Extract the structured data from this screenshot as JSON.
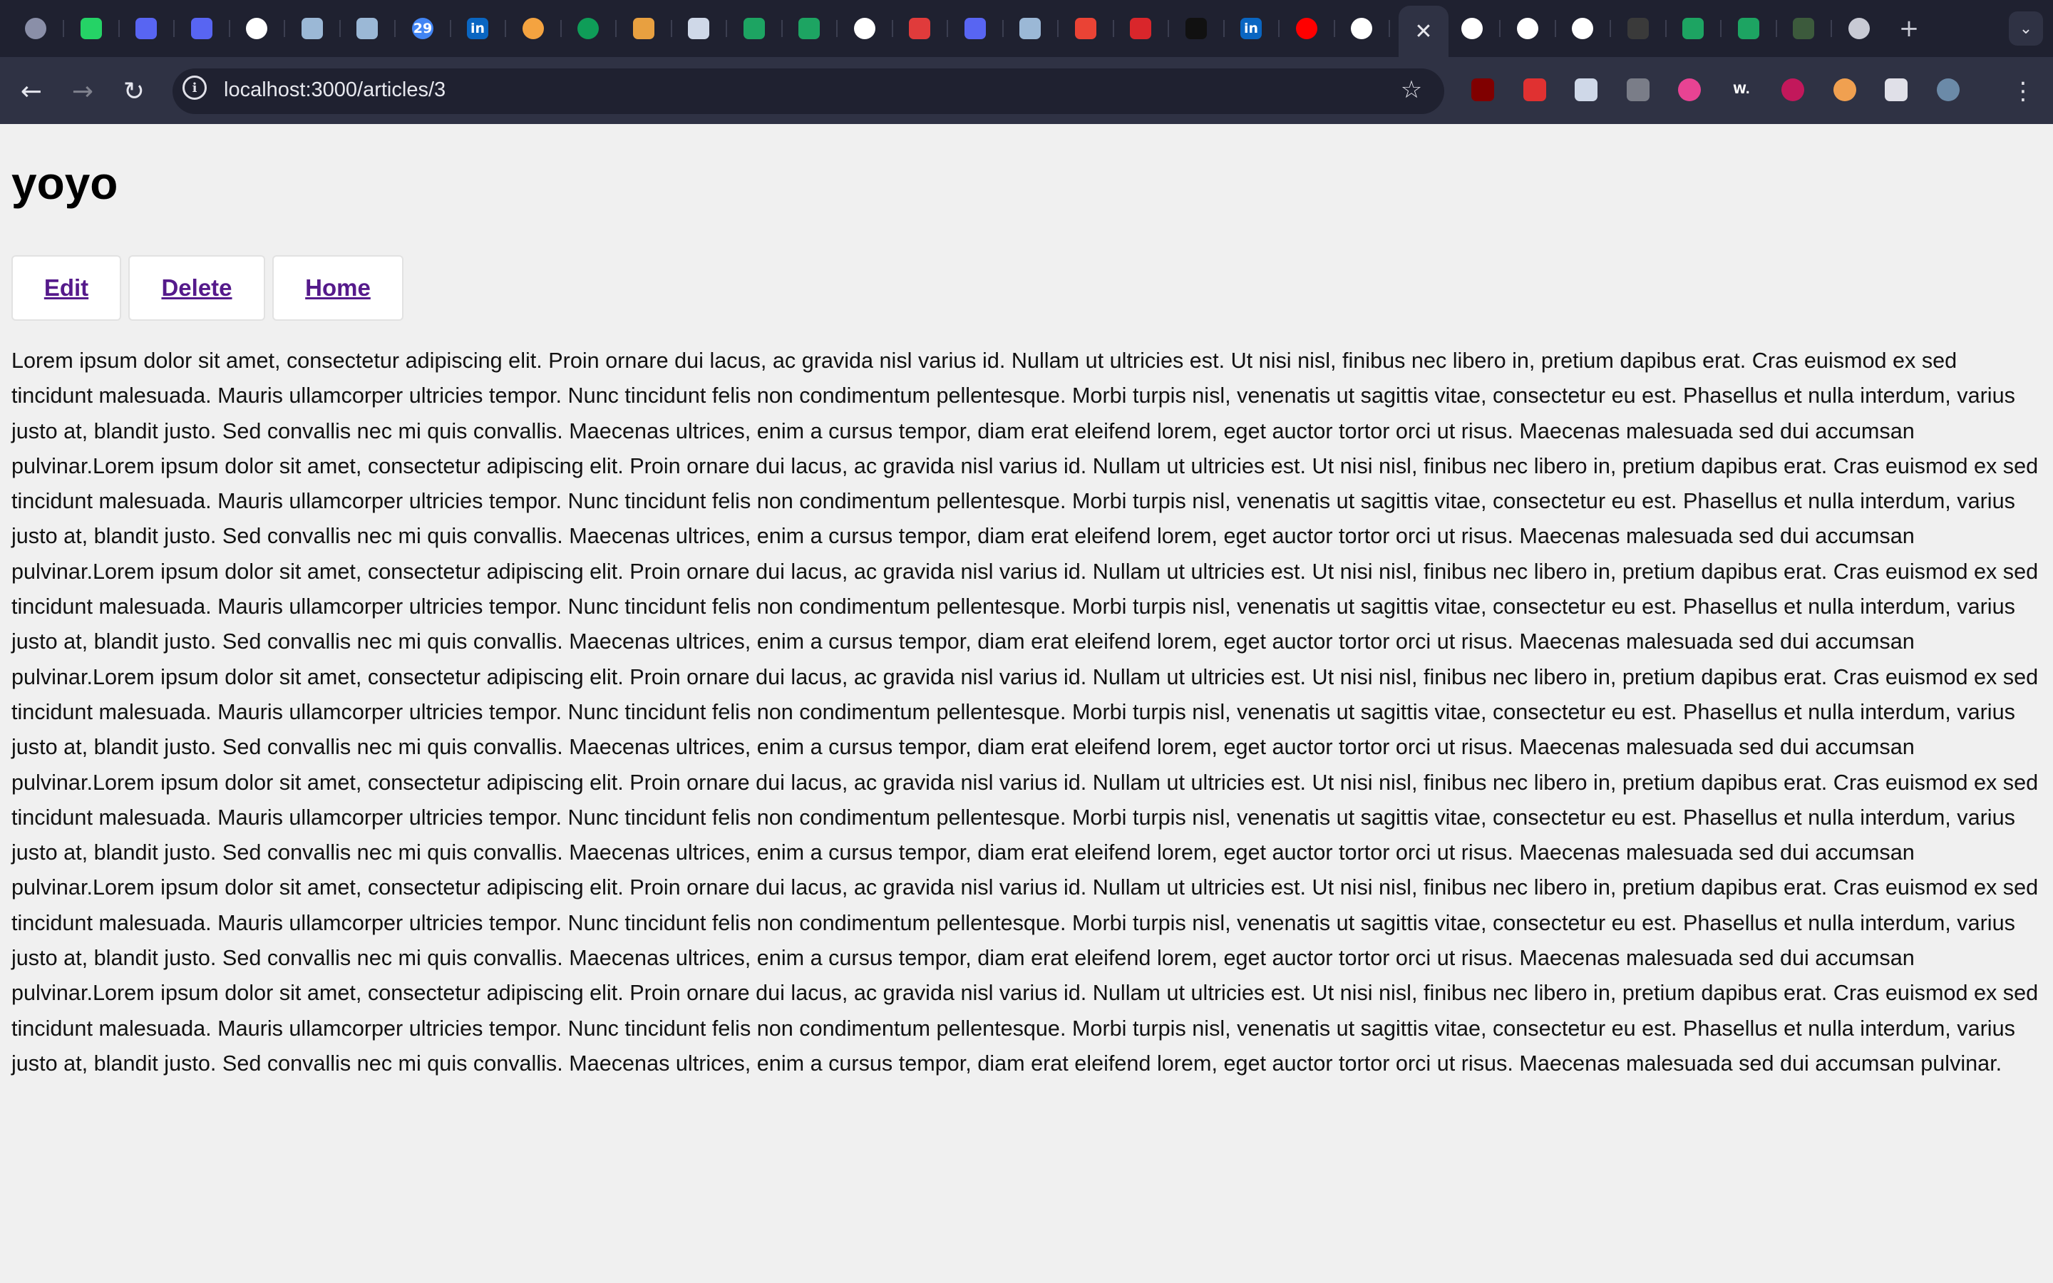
{
  "browser": {
    "tabs": [
      {
        "icon": "circle-dots-icon",
        "color": "#8a8fa8"
      },
      {
        "icon": "whatsapp-icon",
        "color": "#25d366"
      },
      {
        "icon": "pen-nib-icon",
        "color": "#5865f2"
      },
      {
        "icon": "pen-nib-icon",
        "color": "#5865f2"
      },
      {
        "icon": "openai-icon",
        "color": "#ffffff"
      },
      {
        "icon": "cube-icon",
        "color": "#9bb8d6"
      },
      {
        "icon": "cube-icon",
        "color": "#9bb8d6"
      },
      {
        "icon": "google-calendar-icon",
        "color": "#4285f4",
        "text": "29"
      },
      {
        "icon": "linkedin-icon",
        "color": "#0a66c2",
        "text": "in"
      },
      {
        "icon": "gradient-circle-icon",
        "color": "#f4a340"
      },
      {
        "icon": "google-sheets-icon",
        "color": "#0f9d58"
      },
      {
        "icon": "sorting-bars-icon",
        "color": "#e8a040"
      },
      {
        "icon": "mountain-icon",
        "color": "#cfd8e8"
      },
      {
        "icon": "w-logo-icon",
        "color": "#1da462"
      },
      {
        "icon": "infinity-icon",
        "color": "#1da462"
      },
      {
        "icon": "google-icon",
        "color": "#ffffff"
      },
      {
        "icon": "ts-logo-icon",
        "color": "#e03b3b"
      },
      {
        "icon": "pen-nib-icon",
        "color": "#5865f2"
      },
      {
        "icon": "cube-icon",
        "color": "#9bb8d6"
      },
      {
        "icon": "gmail-icon",
        "color": "#ea4335"
      },
      {
        "icon": "dragon-icon",
        "color": "#d9262b"
      },
      {
        "icon": "letter-m-icon",
        "color": "#111111"
      },
      {
        "icon": "linkedin-icon",
        "color": "#0a66c2",
        "text": "in"
      },
      {
        "icon": "youtube-icon",
        "color": "#ff0000"
      },
      {
        "icon": "openai-icon",
        "color": "#ffffff"
      },
      {
        "icon": "close-icon",
        "color": "#2f3244",
        "active": true
      },
      {
        "icon": "github-icon",
        "color": "#ffffff"
      },
      {
        "icon": "google-icon",
        "color": "#ffffff"
      },
      {
        "icon": "openai-icon",
        "color": "#ffffff"
      },
      {
        "icon": "terminal-icon",
        "color": "#3a3a3a"
      },
      {
        "icon": "w-logo-icon",
        "color": "#1da462"
      },
      {
        "icon": "w-logo-icon",
        "color": "#1da462"
      },
      {
        "icon": "cursor-app-icon",
        "color": "#3c5a3c"
      },
      {
        "icon": "chrome-icon",
        "color": "#c8cad4"
      }
    ],
    "url": "localhost:3000/articles/3",
    "extensions": [
      {
        "icon": "ublock-icon",
        "color": "#800000"
      },
      {
        "icon": "video-speed-icon",
        "color": "#e03131"
      },
      {
        "icon": "react-devtools-icon",
        "color": "#cfd8e8"
      },
      {
        "icon": "robot-icon",
        "color": "#7a7d88"
      },
      {
        "icon": "color-wheel-icon",
        "color": "#e84393"
      },
      {
        "icon": "w-dot-icon",
        "color": "#ffffff",
        "text": "W."
      },
      {
        "icon": "play-circle-icon",
        "color": "#c2185b"
      },
      {
        "icon": "capsule-icon",
        "color": "#f0a050"
      },
      {
        "icon": "puzzle-icon",
        "color": "#e0e0e8"
      },
      {
        "icon": "profile-avatar-icon",
        "color": "#6b8aa8"
      }
    ]
  },
  "article": {
    "title": "yoyo",
    "actions": [
      {
        "label": "Edit"
      },
      {
        "label": "Delete"
      },
      {
        "label": "Home"
      }
    ],
    "body": "Lorem ipsum dolor sit amet, consectetur adipiscing elit. Proin ornare dui lacus, ac gravida nisl varius id. Nullam ut ultricies est. Ut nisi nisl, finibus nec libero in, pretium dapibus erat. Cras euismod ex sed tincidunt malesuada. Mauris ullamcorper ultricies tempor. Nunc tincidunt felis non condimentum pellentesque. Morbi turpis nisl, venenatis ut sagittis vitae, consectetur eu est. Phasellus et nulla interdum, varius justo at, blandit justo. Sed convallis nec mi quis convallis. Maecenas ultrices, enim a cursus tempor, diam erat eleifend lorem, eget auctor tortor orci ut risus. Maecenas malesuada sed dui accumsan pulvinar.Lorem ipsum dolor sit amet, consectetur adipiscing elit. Proin ornare dui lacus, ac gravida nisl varius id. Nullam ut ultricies est. Ut nisi nisl, finibus nec libero in, pretium dapibus erat. Cras euismod ex sed tincidunt malesuada. Mauris ullamcorper ultricies tempor. Nunc tincidunt felis non condimentum pellentesque. Morbi turpis nisl, venenatis ut sagittis vitae, consectetur eu est. Phasellus et nulla interdum, varius justo at, blandit justo. Sed convallis nec mi quis convallis. Maecenas ultrices, enim a cursus tempor, diam erat eleifend lorem, eget auctor tortor orci ut risus. Maecenas malesuada sed dui accumsan pulvinar.Lorem ipsum dolor sit amet, consectetur adipiscing elit. Proin ornare dui lacus, ac gravida nisl varius id. Nullam ut ultricies est. Ut nisi nisl, finibus nec libero in, pretium dapibus erat. Cras euismod ex sed tincidunt malesuada. Mauris ullamcorper ultricies tempor. Nunc tincidunt felis non condimentum pellentesque. Morbi turpis nisl, venenatis ut sagittis vitae, consectetur eu est. Phasellus et nulla interdum, varius justo at, blandit justo. Sed convallis nec mi quis convallis. Maecenas ultrices, enim a cursus tempor, diam erat eleifend lorem, eget auctor tortor orci ut risus. Maecenas malesuada sed dui accumsan pulvinar.Lorem ipsum dolor sit amet, consectetur adipiscing elit. Proin ornare dui lacus, ac gravida nisl varius id. Nullam ut ultricies est. Ut nisi nisl, finibus nec libero in, pretium dapibus erat. Cras euismod ex sed tincidunt malesuada. Mauris ullamcorper ultricies tempor. Nunc tincidunt felis non condimentum pellentesque. Morbi turpis nisl, venenatis ut sagittis vitae, consectetur eu est. Phasellus et nulla interdum, varius justo at, blandit justo. Sed convallis nec mi quis convallis. Maecenas ultrices, enim a cursus tempor, diam erat eleifend lorem, eget auctor tortor orci ut risus. Maecenas malesuada sed dui accumsan pulvinar.Lorem ipsum dolor sit amet, consectetur adipiscing elit. Proin ornare dui lacus, ac gravida nisl varius id. Nullam ut ultricies est. Ut nisi nisl, finibus nec libero in, pretium dapibus erat. Cras euismod ex sed tincidunt malesuada. Mauris ullamcorper ultricies tempor. Nunc tincidunt felis non condimentum pellentesque. Morbi turpis nisl, venenatis ut sagittis vitae, consectetur eu est. Phasellus et nulla interdum, varius justo at, blandit justo. Sed convallis nec mi quis convallis. Maecenas ultrices, enim a cursus tempor, diam erat eleifend lorem, eget auctor tortor orci ut risus. Maecenas malesuada sed dui accumsan pulvinar.Lorem ipsum dolor sit amet, consectetur adipiscing elit. Proin ornare dui lacus, ac gravida nisl varius id. Nullam ut ultricies est. Ut nisi nisl, finibus nec libero in, pretium dapibus erat. Cras euismod ex sed tincidunt malesuada. Mauris ullamcorper ultricies tempor. Nunc tincidunt felis non condimentum pellentesque. Morbi turpis nisl, venenatis ut sagittis vitae, consectetur eu est. Phasellus et nulla interdum, varius justo at, blandit justo. Sed convallis nec mi quis convallis. Maecenas ultrices, enim a cursus tempor, diam erat eleifend lorem, eget auctor tortor orci ut risus. Maecenas malesuada sed dui accumsan pulvinar.Lorem ipsum dolor sit amet, consectetur adipiscing elit. Proin ornare dui lacus, ac gravida nisl varius id. Nullam ut ultricies est. Ut nisi nisl, finibus nec libero in, pretium dapibus erat. Cras euismod ex sed tincidunt malesuada. Mauris ullamcorper ultricies tempor. Nunc tincidunt felis non condimentum pellentesque. Morbi turpis nisl, venenatis ut sagittis vitae, consectetur eu est. Phasellus et nulla interdum, varius justo at, blandit justo. Sed convallis nec mi quis convallis. Maecenas ultrices, enim a cursus tempor, diam erat eleifend lorem, eget auctor tortor orci ut risus. Maecenas malesuada sed dui accumsan pulvinar."
  }
}
